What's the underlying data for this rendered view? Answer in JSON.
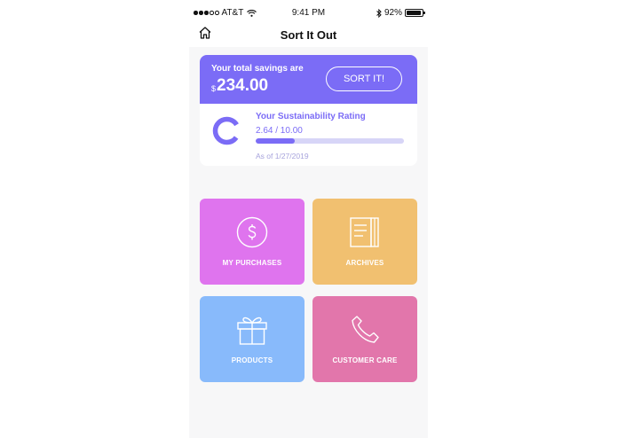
{
  "status_bar": {
    "carrier": "AT&T",
    "time": "9:41 PM",
    "battery": "92%",
    "battery_level": 0.92,
    "signal_bars_filled": 3,
    "signal_bars_total": 5
  },
  "nav": {
    "title": "Sort It Out",
    "home_icon": "home-icon"
  },
  "savings": {
    "label": "Your total savings are",
    "currency": "$",
    "amount": "234.00",
    "button_label": "SORT IT!"
  },
  "rating": {
    "title": "Your Sustainability Rating",
    "value_text": "2.64 / 10.00",
    "value": 2.64,
    "max": 10,
    "date": "As of 1/27/2019"
  },
  "tiles": [
    {
      "label": "MY PURCHASES",
      "icon": "dollar-circle-icon",
      "color": "#df74ee"
    },
    {
      "label": "ARCHIVES",
      "icon": "book-icon",
      "color": "#f1c070"
    },
    {
      "label": "PRODUCTS",
      "icon": "gift-icon",
      "color": "#88bafb"
    },
    {
      "label": "CUSTOMER CARE",
      "icon": "phone-icon",
      "color": "#e276ab"
    }
  ],
  "colors": {
    "accent": "#7b6cf6",
    "track": "#d7d5f7",
    "background": "#f7f7f8"
  }
}
